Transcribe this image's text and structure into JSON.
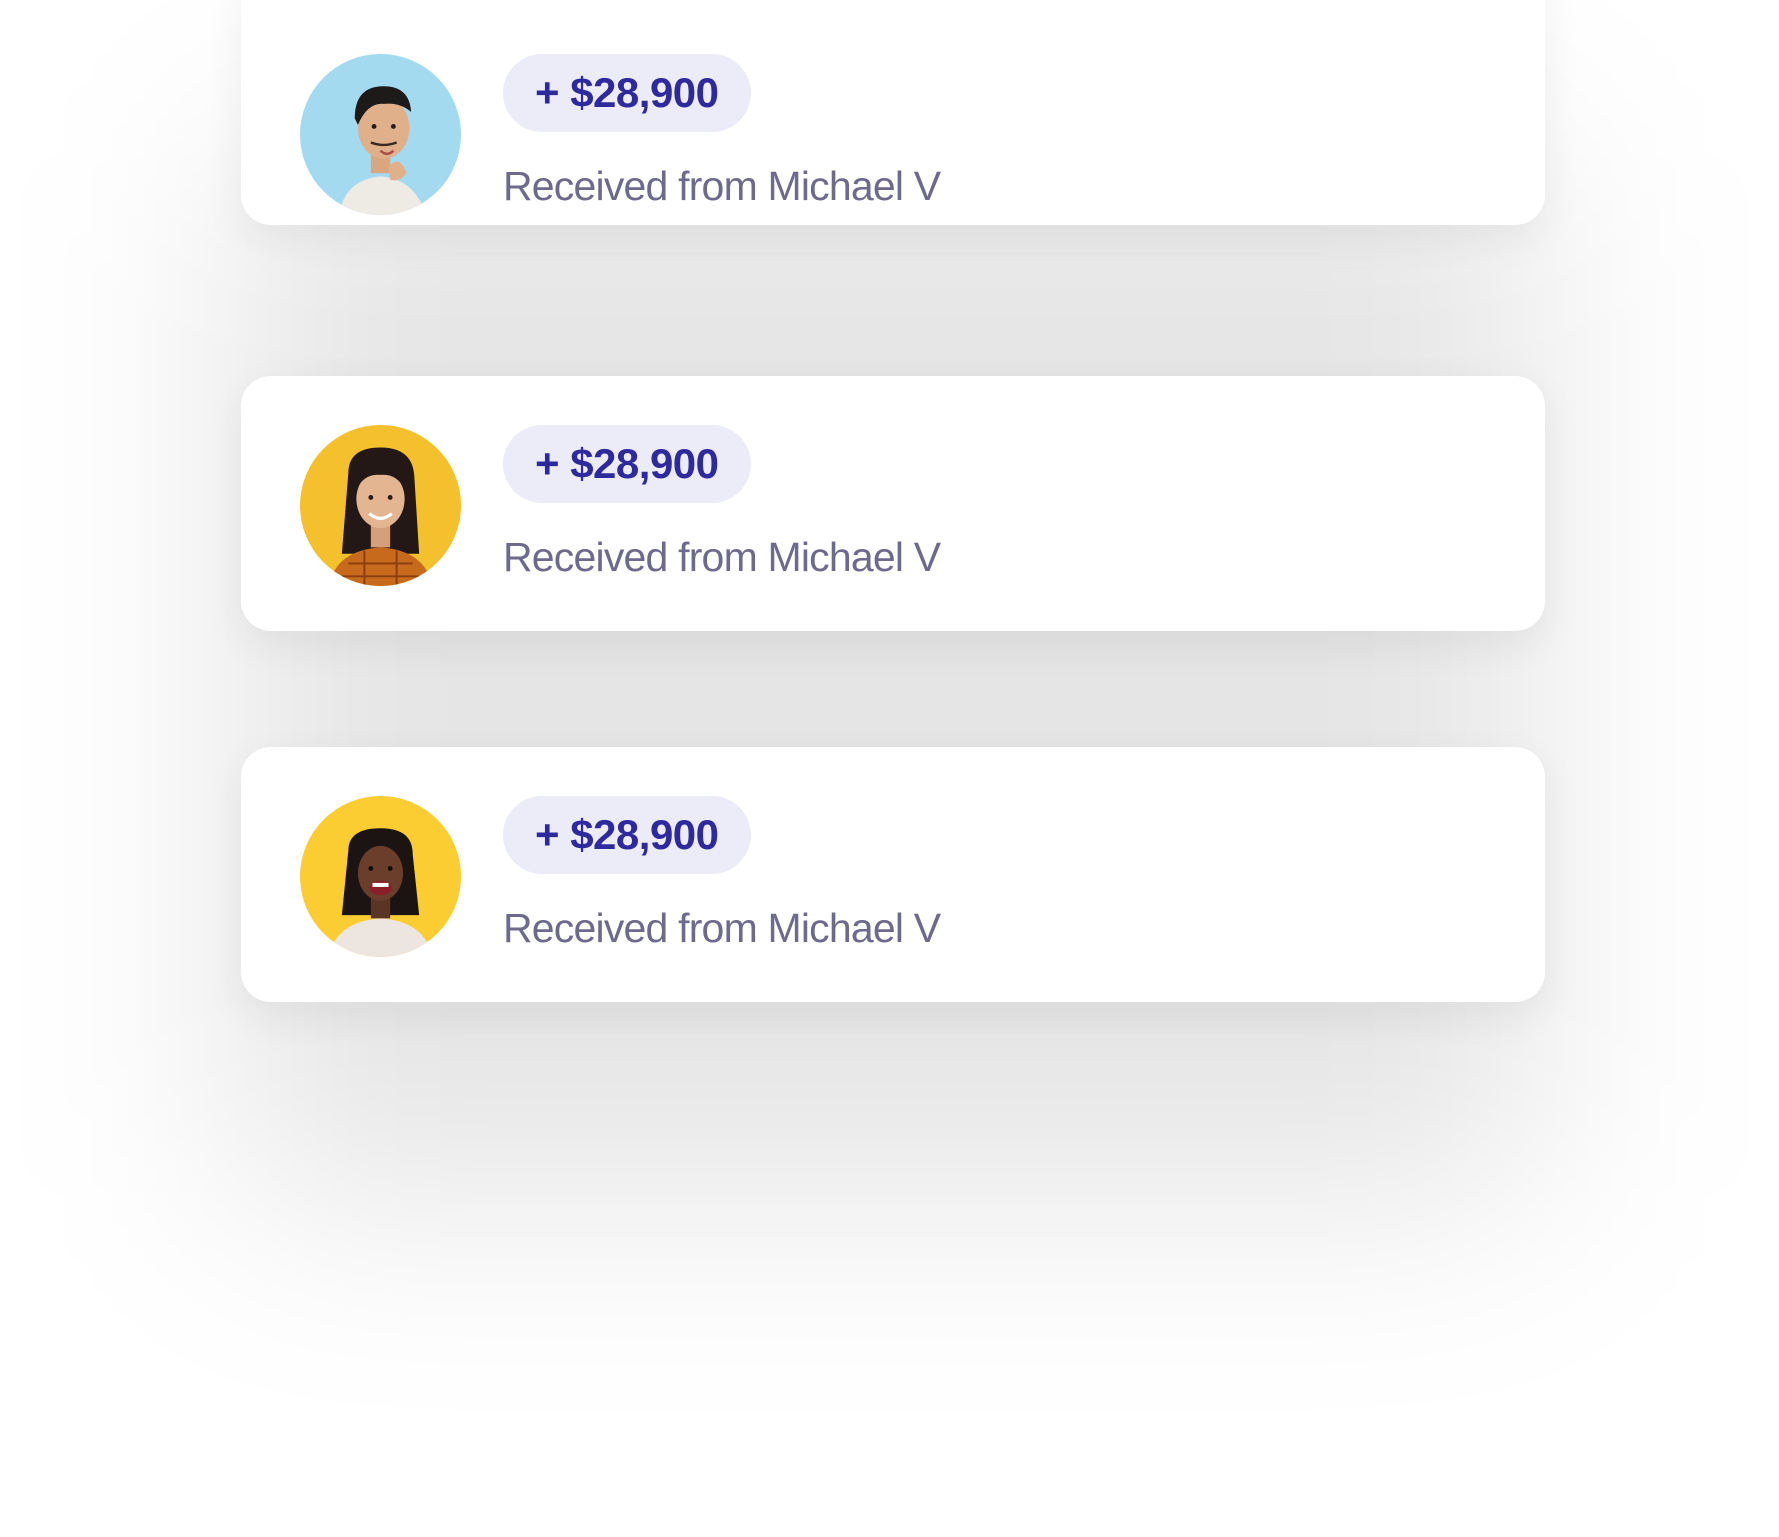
{
  "colors": {
    "pill_bg": "#ecebf8",
    "amount_text": "#2e2a9e",
    "desc_text": "#6d6a8e",
    "card_bg": "#ffffff"
  },
  "transactions": [
    {
      "amount": "+ $28,900",
      "description": "Received from Michael V",
      "avatar_icon": "person-avatar-blue-bg",
      "avatar_bg": "#a3daf0"
    },
    {
      "amount": "+ $28,900",
      "description": "Received from Michael V",
      "avatar_icon": "person-avatar-yellow-bg",
      "avatar_bg": "#f4c02e"
    },
    {
      "amount": "+ $28,900",
      "description": "Received from Michael V",
      "avatar_icon": "person-avatar-yellow-bg",
      "avatar_bg": "#fccd32"
    }
  ]
}
